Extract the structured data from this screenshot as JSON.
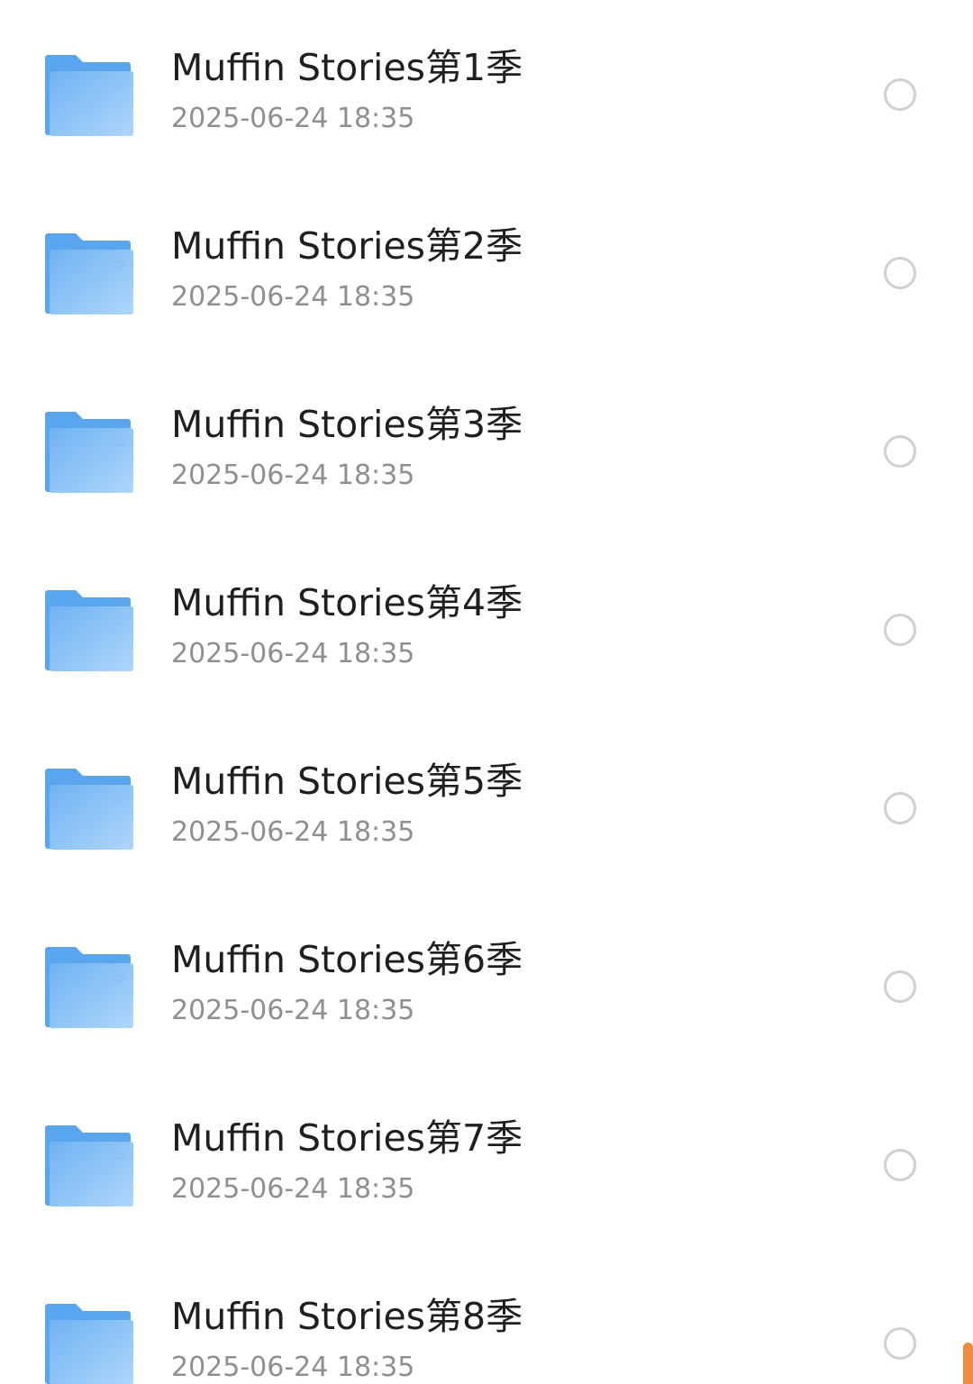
{
  "folders": [
    {
      "name": "Muffin Stories第1季",
      "date": "2025-06-24 18:35",
      "icon": "folder-icon"
    },
    {
      "name": "Muffin Stories第2季",
      "date": "2025-06-24 18:35",
      "icon": "folder-icon"
    },
    {
      "name": "Muffin Stories第3季",
      "date": "2025-06-24 18:35",
      "icon": "folder-icon"
    },
    {
      "name": "Muffin Stories第4季",
      "date": "2025-06-24 18:35",
      "icon": "folder-icon"
    },
    {
      "name": "Muffin Stories第5季",
      "date": "2025-06-24 18:35",
      "icon": "folder-icon"
    },
    {
      "name": "Muffin Stories第6季",
      "date": "2025-06-24 18:35",
      "icon": "folder-icon"
    },
    {
      "name": "Muffin Stories第7季",
      "date": "2025-06-24 18:35",
      "icon": "folder-icon"
    },
    {
      "name": "Muffin Stories第8季",
      "date": "2025-06-24 18:35",
      "icon": "folder-icon"
    }
  ],
  "colors": {
    "folder_back": "#5aa6ee",
    "folder_front_top": "#6fb3f2",
    "folder_front_bottom": "#a9d4fb",
    "title_text": "#1f1f1f",
    "date_text": "#8f8f8f",
    "radio_border": "#cfcfd4",
    "scrollbar": "#f08c3a"
  }
}
